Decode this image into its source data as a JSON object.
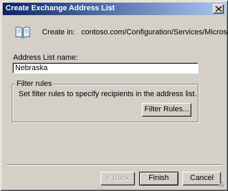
{
  "window": {
    "title": "Create Exchange Address List"
  },
  "header": {
    "icon": "address-book-icon",
    "create_in_label": "Create in:",
    "create_in_path": "contoso.com/Configuration/Services/Microsoft"
  },
  "form": {
    "name_label": "Address List name:",
    "name_value": "Nebraska"
  },
  "filter_group": {
    "legend": "Filter rules",
    "description": "Set filter rules to specify recipients in the address list.",
    "button_label": "Filter Rules..."
  },
  "footer": {
    "back_label": "< Back",
    "finish_label": "Finish",
    "cancel_label": "Cancel"
  },
  "colors": {
    "titlebar_start": "#0a246a",
    "titlebar_end": "#a6caf0",
    "window_bg": "#d4d0c8"
  }
}
